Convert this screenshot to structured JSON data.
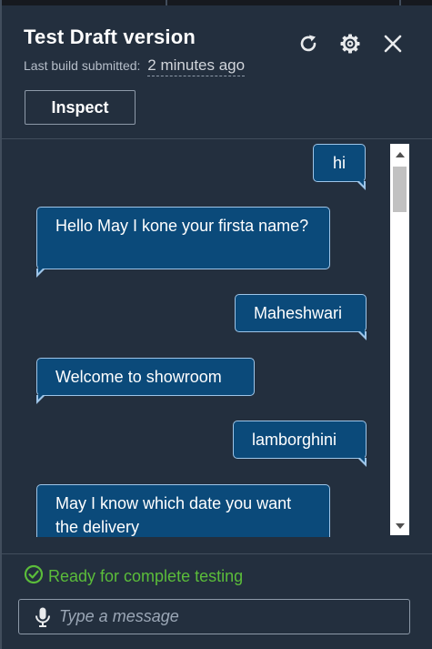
{
  "header": {
    "title": "Test Draft version",
    "build_label": "Last build submitted:",
    "build_time": "2 minutes ago",
    "inspect_label": "Inspect"
  },
  "icons": {
    "refresh": "refresh-icon",
    "settings": "gear-icon",
    "close": "close-icon",
    "status": "check-circle-icon",
    "mic": "microphone-icon"
  },
  "messages": [
    {
      "sender": "user",
      "text": "hi"
    },
    {
      "sender": "bot",
      "text": "Hello May I kone your firsta name?"
    },
    {
      "sender": "user",
      "text": "Maheshwari"
    },
    {
      "sender": "bot",
      "text": "Welcome to showroom"
    },
    {
      "sender": "user",
      "text": "lamborghini"
    },
    {
      "sender": "bot",
      "text": "May I know which date you want the delivery"
    }
  ],
  "status": {
    "text": "Ready for complete testing",
    "color": "#5bbd3a"
  },
  "composer": {
    "placeholder": "Type a message",
    "value": ""
  },
  "colors": {
    "background": "#232f3e",
    "bubble": "#0b4a7a",
    "bubble_border": "#9ec5e8"
  }
}
